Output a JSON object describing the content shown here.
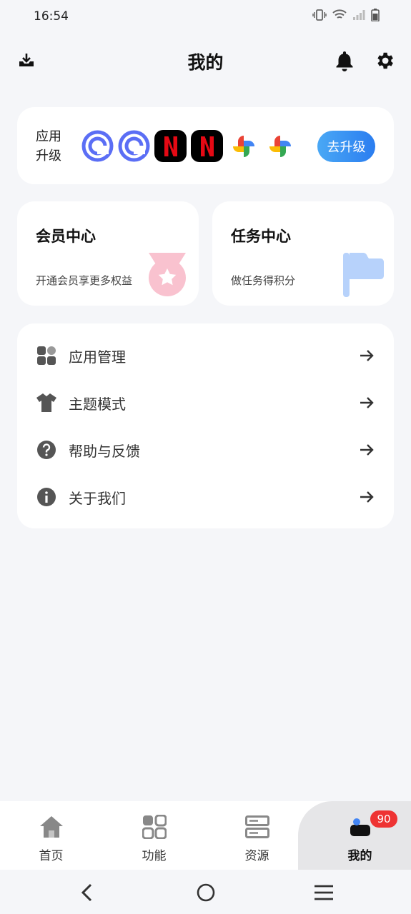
{
  "status_bar": {
    "time": "16:54"
  },
  "header": {
    "title": "我的"
  },
  "upgrade": {
    "label_line1": "应用",
    "label_line2": "升级",
    "button_label": "去升级",
    "apps": [
      "app-c-icon",
      "app-c-icon",
      "netflix-icon",
      "netflix-icon",
      "pinwheel-icon",
      "pinwheel-icon"
    ]
  },
  "member_center": {
    "title": "会员中心",
    "subtitle": "开通会员享更多权益"
  },
  "task_center": {
    "title": "任务中心",
    "subtitle": "做任务得积分"
  },
  "menu": {
    "items": [
      {
        "label": "应用管理",
        "icon": "apps-grid-icon"
      },
      {
        "label": "主题模式",
        "icon": "tshirt-icon"
      },
      {
        "label": "帮助与反馈",
        "icon": "help-icon"
      },
      {
        "label": "关于我们",
        "icon": "info-icon"
      }
    ]
  },
  "bottom_nav": {
    "items": [
      {
        "label": "首页",
        "icon": "home-icon"
      },
      {
        "label": "功能",
        "icon": "function-grid-icon"
      },
      {
        "label": "资源",
        "icon": "server-icon"
      },
      {
        "label": "我的",
        "icon": "profile-icon"
      }
    ],
    "active_index": 3,
    "badge": "90"
  },
  "colors": {
    "accent": "#2a7df0",
    "badge": "#e33333",
    "background": "#f5f6f9",
    "member_icon": "#f9c2cf",
    "task_icon": "#b7d2fb"
  }
}
